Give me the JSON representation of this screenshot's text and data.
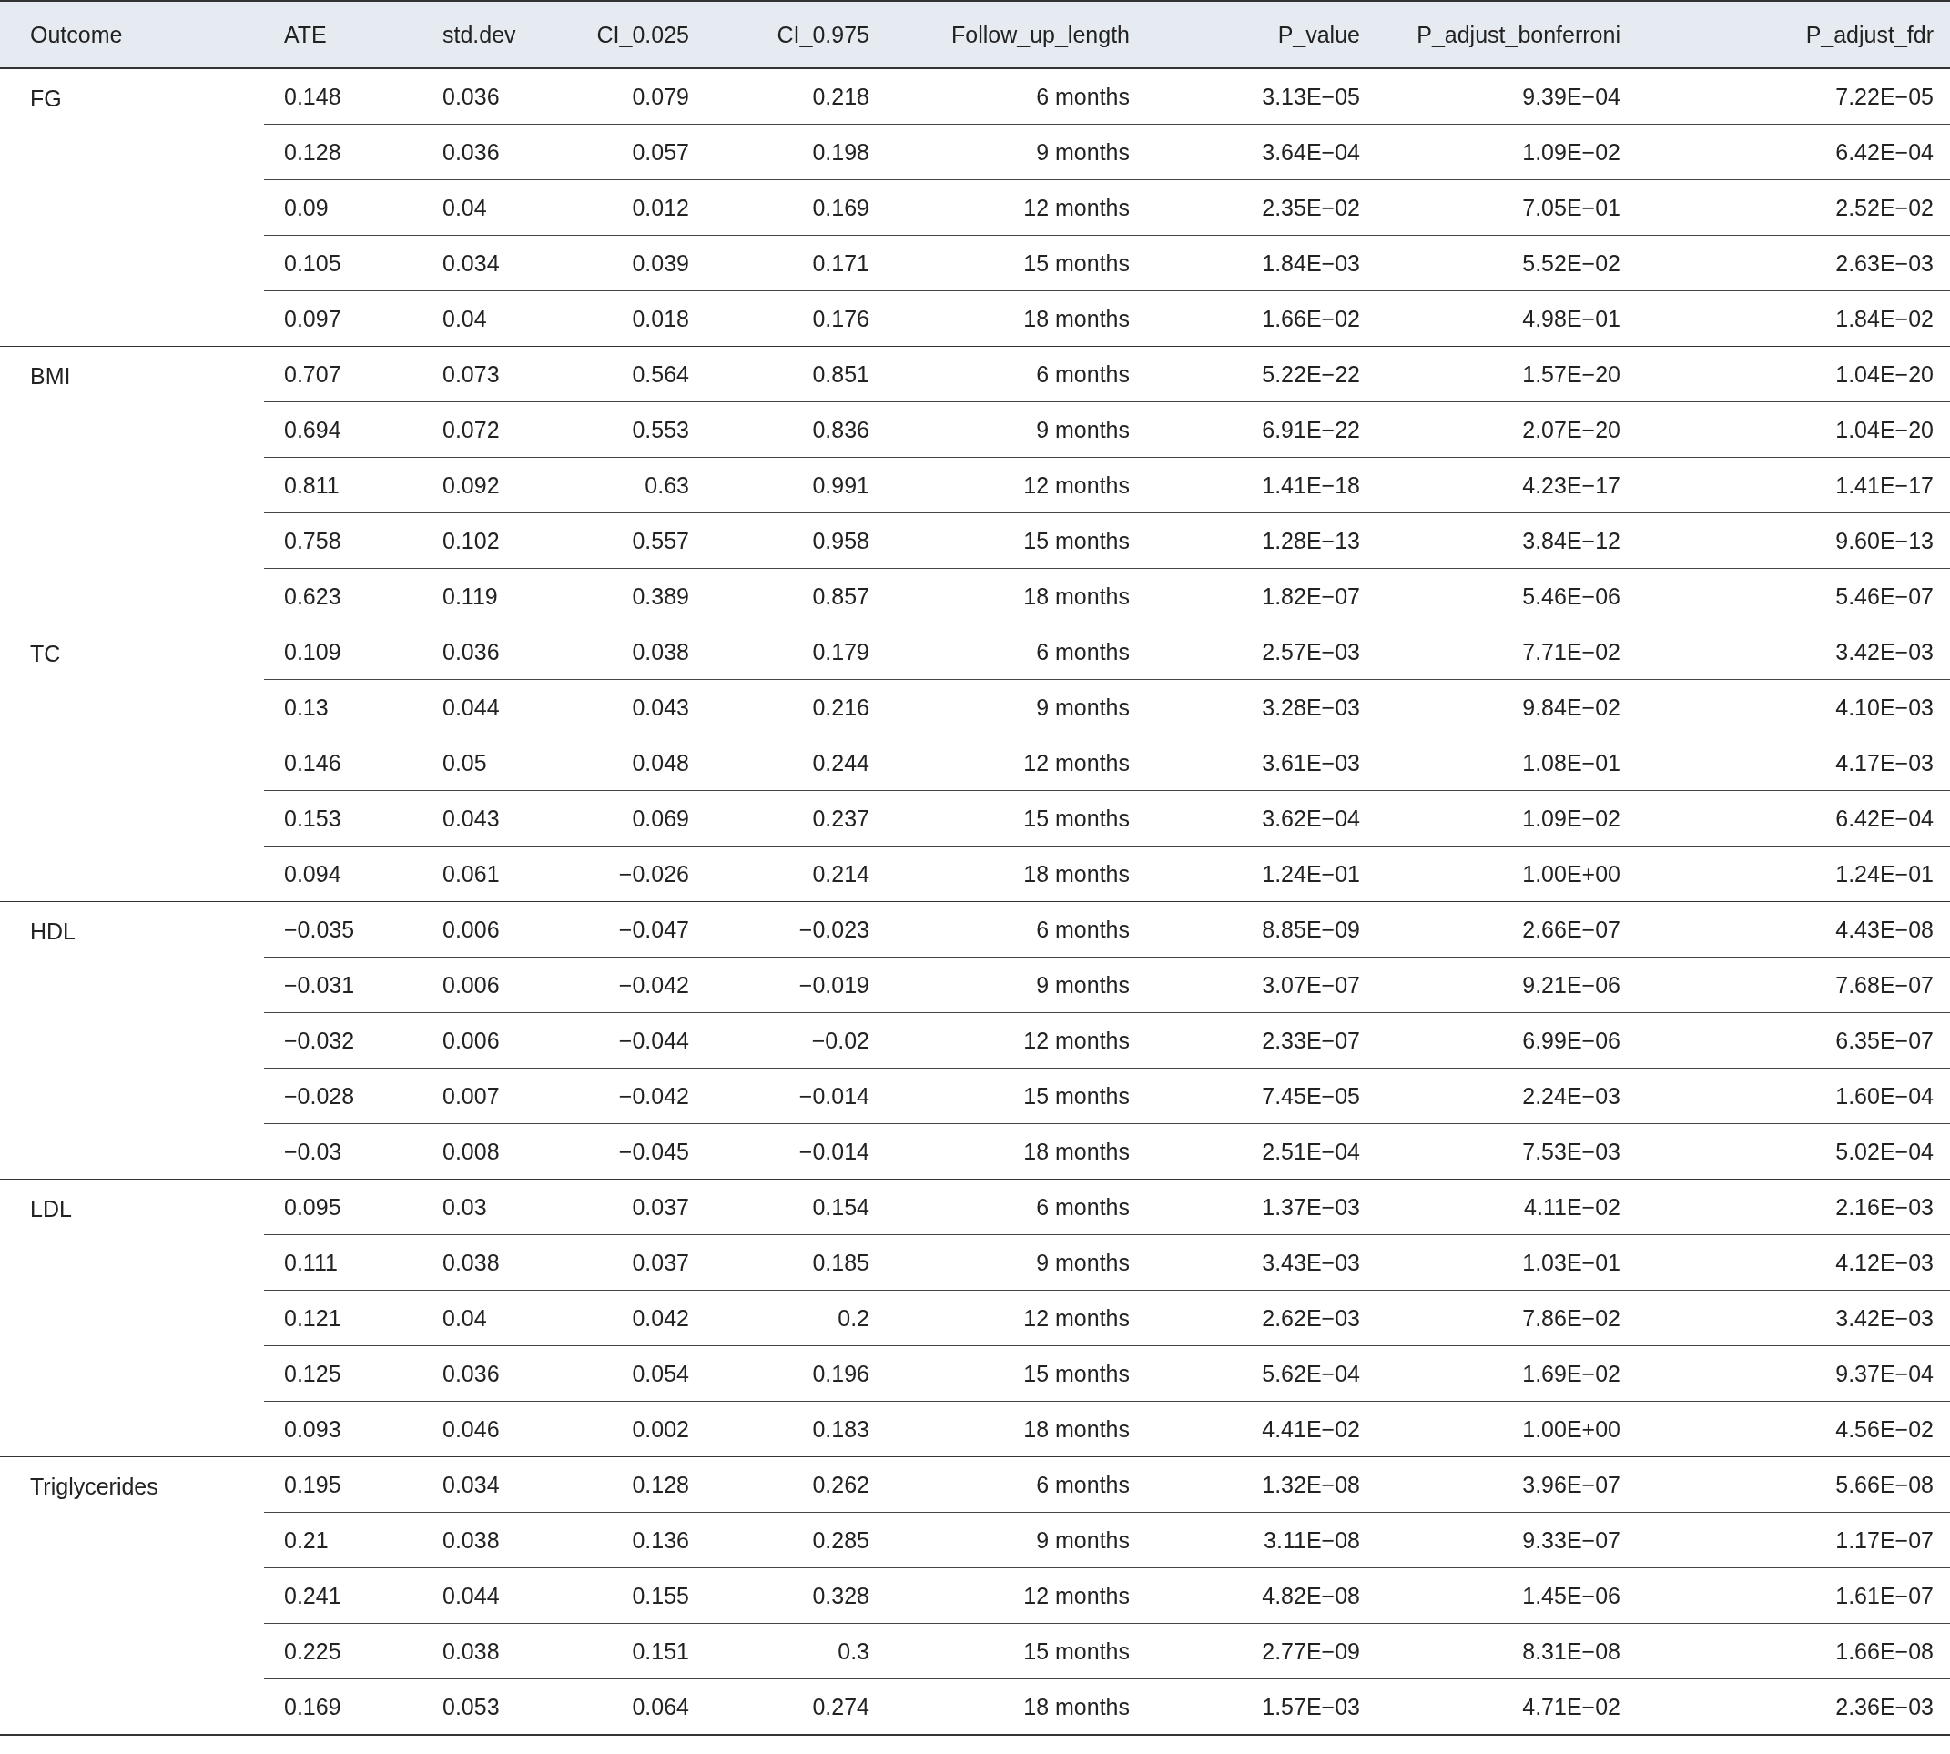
{
  "table": {
    "columns": [
      "Outcome",
      "ATE",
      "std.dev",
      "CI_0.025",
      "CI_0.975",
      "Follow_up_length",
      "P_value",
      "P_adjust_bonferroni",
      "P_adjust_fdr"
    ],
    "groups": [
      {
        "outcome": "FG",
        "rows": [
          [
            "0.148",
            "0.036",
            "0.079",
            "0.218",
            "6 months",
            "3.13E−05",
            "9.39E−04",
            "7.22E−05"
          ],
          [
            "0.128",
            "0.036",
            "0.057",
            "0.198",
            "9 months",
            "3.64E−04",
            "1.09E−02",
            "6.42E−04"
          ],
          [
            "0.09",
            "0.04",
            "0.012",
            "0.169",
            "12 months",
            "2.35E−02",
            "7.05E−01",
            "2.52E−02"
          ],
          [
            "0.105",
            "0.034",
            "0.039",
            "0.171",
            "15 months",
            "1.84E−03",
            "5.52E−02",
            "2.63E−03"
          ],
          [
            "0.097",
            "0.04",
            "0.018",
            "0.176",
            "18 months",
            "1.66E−02",
            "4.98E−01",
            "1.84E−02"
          ]
        ]
      },
      {
        "outcome": "BMI",
        "rows": [
          [
            "0.707",
            "0.073",
            "0.564",
            "0.851",
            "6 months",
            "5.22E−22",
            "1.57E−20",
            "1.04E−20"
          ],
          [
            "0.694",
            "0.072",
            "0.553",
            "0.836",
            "9 months",
            "6.91E−22",
            "2.07E−20",
            "1.04E−20"
          ],
          [
            "0.811",
            "0.092",
            "0.63",
            "0.991",
            "12 months",
            "1.41E−18",
            "4.23E−17",
            "1.41E−17"
          ],
          [
            "0.758",
            "0.102",
            "0.557",
            "0.958",
            "15 months",
            "1.28E−13",
            "3.84E−12",
            "9.60E−13"
          ],
          [
            "0.623",
            "0.119",
            "0.389",
            "0.857",
            "18 months",
            "1.82E−07",
            "5.46E−06",
            "5.46E−07"
          ]
        ]
      },
      {
        "outcome": "TC",
        "rows": [
          [
            "0.109",
            "0.036",
            "0.038",
            "0.179",
            "6 months",
            "2.57E−03",
            "7.71E−02",
            "3.42E−03"
          ],
          [
            "0.13",
            "0.044",
            "0.043",
            "0.216",
            "9 months",
            "3.28E−03",
            "9.84E−02",
            "4.10E−03"
          ],
          [
            "0.146",
            "0.05",
            "0.048",
            "0.244",
            "12 months",
            "3.61E−03",
            "1.08E−01",
            "4.17E−03"
          ],
          [
            "0.153",
            "0.043",
            "0.069",
            "0.237",
            "15 months",
            "3.62E−04",
            "1.09E−02",
            "6.42E−04"
          ],
          [
            "0.094",
            "0.061",
            "−0.026",
            "0.214",
            "18 months",
            "1.24E−01",
            "1.00E+00",
            "1.24E−01"
          ]
        ]
      },
      {
        "outcome": "HDL",
        "rows": [
          [
            "−0.035",
            "0.006",
            "−0.047",
            "−0.023",
            "6 months",
            "8.85E−09",
            "2.66E−07",
            "4.43E−08"
          ],
          [
            "−0.031",
            "0.006",
            "−0.042",
            "−0.019",
            "9 months",
            "3.07E−07",
            "9.21E−06",
            "7.68E−07"
          ],
          [
            "−0.032",
            "0.006",
            "−0.044",
            "−0.02",
            "12 months",
            "2.33E−07",
            "6.99E−06",
            "6.35E−07"
          ],
          [
            "−0.028",
            "0.007",
            "−0.042",
            "−0.014",
            "15 months",
            "7.45E−05",
            "2.24E−03",
            "1.60E−04"
          ],
          [
            "−0.03",
            "0.008",
            "−0.045",
            "−0.014",
            "18 months",
            "2.51E−04",
            "7.53E−03",
            "5.02E−04"
          ]
        ]
      },
      {
        "outcome": "LDL",
        "rows": [
          [
            "0.095",
            "0.03",
            "0.037",
            "0.154",
            "6 months",
            "1.37E−03",
            "4.11E−02",
            "2.16E−03"
          ],
          [
            "0.111",
            "0.038",
            "0.037",
            "0.185",
            "9 months",
            "3.43E−03",
            "1.03E−01",
            "4.12E−03"
          ],
          [
            "0.121",
            "0.04",
            "0.042",
            "0.2",
            "12 months",
            "2.62E−03",
            "7.86E−02",
            "3.42E−03"
          ],
          [
            "0.125",
            "0.036",
            "0.054",
            "0.196",
            "15 months",
            "5.62E−04",
            "1.69E−02",
            "9.37E−04"
          ],
          [
            "0.093",
            "0.046",
            "0.002",
            "0.183",
            "18 months",
            "4.41E−02",
            "1.00E+00",
            "4.56E−02"
          ]
        ]
      },
      {
        "outcome": "Triglycerides",
        "rows": [
          [
            "0.195",
            "0.034",
            "0.128",
            "0.262",
            "6 months",
            "1.32E−08",
            "3.96E−07",
            "5.66E−08"
          ],
          [
            "0.21",
            "0.038",
            "0.136",
            "0.285",
            "9 months",
            "3.11E−08",
            "9.33E−07",
            "1.17E−07"
          ],
          [
            "0.241",
            "0.044",
            "0.155",
            "0.328",
            "12 months",
            "4.82E−08",
            "1.45E−06",
            "1.61E−07"
          ],
          [
            "0.225",
            "0.038",
            "0.151",
            "0.3",
            "15 months",
            "2.77E−09",
            "8.31E−08",
            "1.66E−08"
          ],
          [
            "0.169",
            "0.053",
            "0.064",
            "0.274",
            "18 months",
            "1.57E−03",
            "4.71E−02",
            "2.36E−03"
          ]
        ]
      }
    ]
  }
}
